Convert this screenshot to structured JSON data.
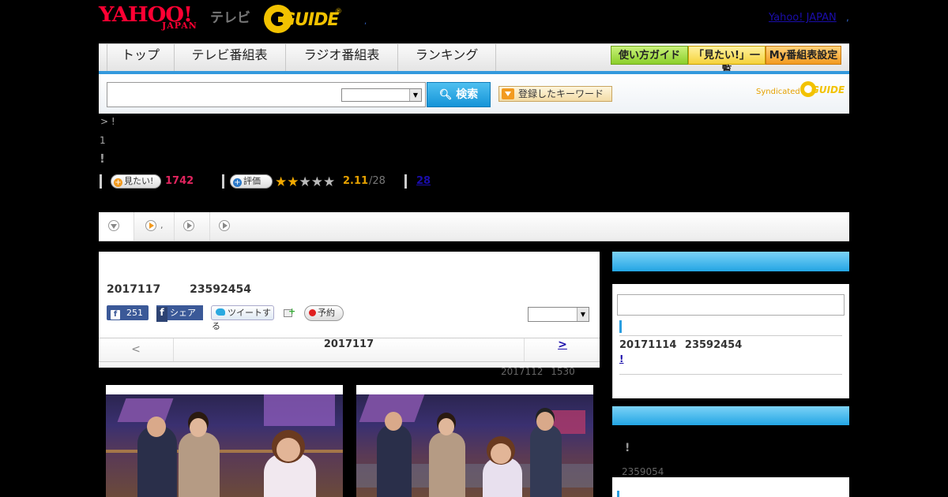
{
  "header": {
    "yahoo_logo_line1": "YAHOO!",
    "yahoo_logo_line2": "JAPAN",
    "tv_label": "テレビ",
    "gguide_logo": "GUIDE",
    "gguide_reg": "®",
    "small_separator": ",",
    "yahoo_japan_link": "Yahoo! JAPAN",
    "link_separator": ","
  },
  "nav": {
    "items": [
      "トップ",
      "テレビ番組表",
      "ラジオ番組表",
      "ランキング"
    ],
    "guide_buttons": [
      "使い方ガイド",
      "「見たい!」一覧",
      "My番組表設定"
    ]
  },
  "search": {
    "input_value": "",
    "select_value": "",
    "button_label": "検索",
    "keyword_button": "登録したキーワード",
    "syndicated_label": "Syndicated",
    "syndicated_logo": "GUIDE"
  },
  "breadcrumb": {
    "text": "> !"
  },
  "program": {
    "line1": "1",
    "title": "!"
  },
  "rating_row": {
    "want_button": "見たい!",
    "want_count": "1742",
    "rate_button": "評価",
    "score": "2.11",
    "score_count": "/28",
    "stars_filled": 2,
    "stars_total": 5,
    "review_link": "28"
  },
  "tabs": {
    "tab2_suffix": ","
  },
  "main": {
    "date_line": "2017117",
    "date_line_id": "23592454",
    "fb_count": "251",
    "share_label": "シェア",
    "tweet_label": "ツイートする",
    "rec_label": "予約",
    "select_value": "",
    "pager_prev": "<",
    "pager_center": "2017117",
    "pager_next": ">",
    "timestamp_date": "2017112",
    "timestamp_time": "1530"
  },
  "sidebar": {
    "input_value": "",
    "item_date": "20171114",
    "item_id": "23592454",
    "item_link": "!",
    "box2_title": "!",
    "box2_sub": "2359054"
  },
  "colors": {
    "accent_blue": "#23a5e4",
    "yahoo_red": "#ff0033",
    "gguide_yellow": "#f2c200",
    "want_pink": "#e0245e",
    "score_orange": "#e6a100"
  }
}
